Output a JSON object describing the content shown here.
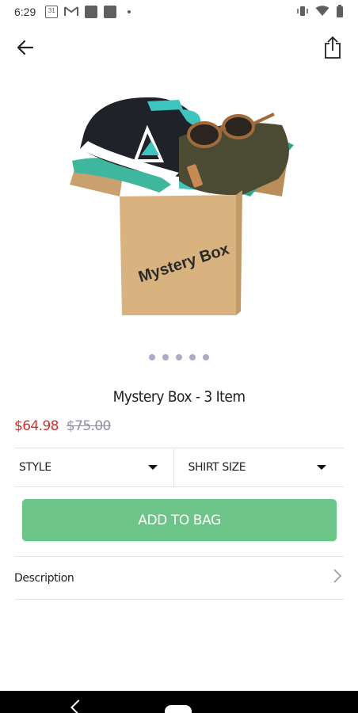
{
  "status_bar": {
    "time": "6:29",
    "calendar_day": "31",
    "icons": [
      "calendar-icon",
      "gmail-icon",
      "app-icon",
      "app-icon",
      "notification-dot",
      "vibrate-icon",
      "wifi-icon",
      "battery-icon"
    ]
  },
  "app_bar": {
    "back_icon": "arrow-left-icon",
    "share_icon": "share-icon"
  },
  "product": {
    "image_text": "Mystery Box",
    "image_alt": "Mystery Box",
    "carousel_count": 5,
    "title": "Mystery Box - 3 Item",
    "sale_price": "$64.98",
    "original_price": "$75.00"
  },
  "options": [
    {
      "label": "STYLE"
    },
    {
      "label": "SHIRT SIZE"
    }
  ],
  "add_to_bag_label": "ADD TO BAG",
  "description_label": "Description",
  "colors": {
    "sale_price": "#d0312d",
    "original_price": "#8d8fa8",
    "accent_button": "#6dc488",
    "carousel_dot": "#a9acc6"
  }
}
